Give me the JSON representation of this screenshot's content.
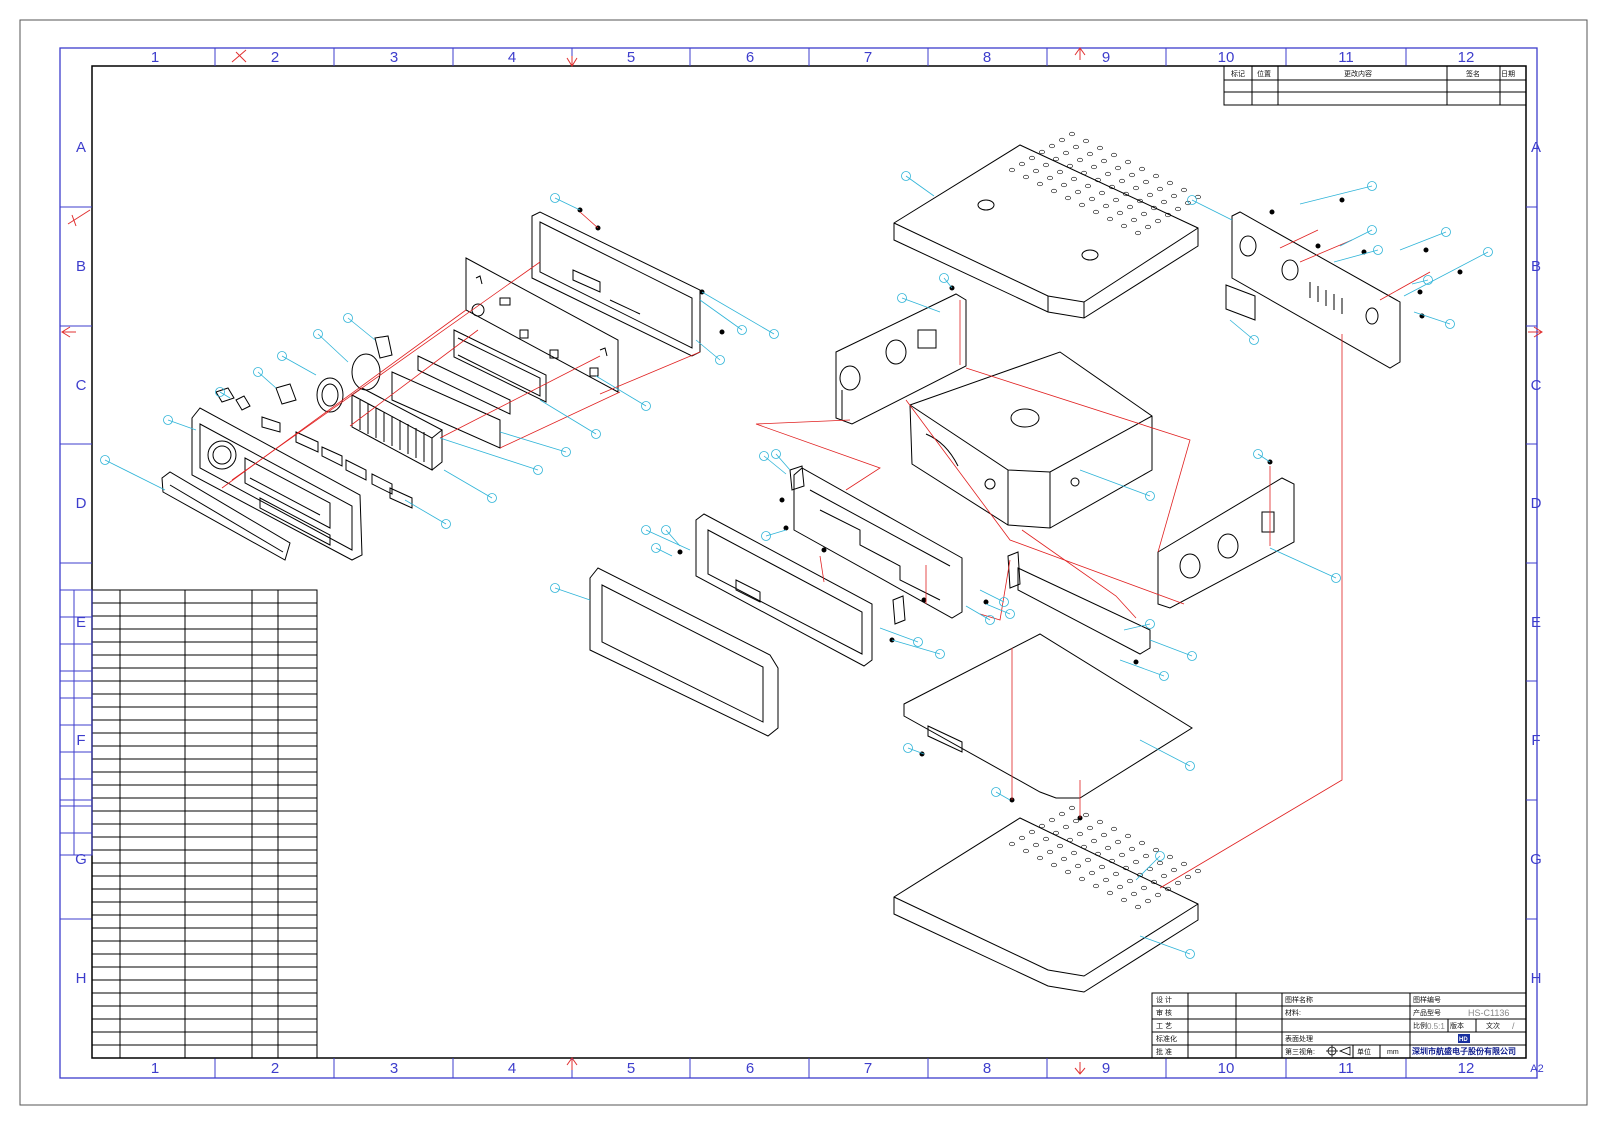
{
  "drawing": {
    "zone_columns": [
      "1",
      "2",
      "3",
      "4",
      "5",
      "6",
      "7",
      "8",
      "9",
      "10",
      "11",
      "12"
    ],
    "zone_rows": [
      "A",
      "B",
      "C",
      "D",
      "E",
      "F",
      "G",
      "H"
    ],
    "sheet_size": "A2"
  },
  "revision_table": {
    "headers": [
      "标记",
      "位置",
      "更改内容",
      "签名",
      "日期"
    ]
  },
  "title_block": {
    "design": "设 计",
    "review": "审 核",
    "process": "工 艺",
    "standard": "标准化",
    "approve": "批 准",
    "drawing_name": "图样名称",
    "material": "材料:",
    "surface": "表面处理",
    "projection": "第三视角:",
    "unit": "单位",
    "unit_value": "mm",
    "drawing_no": "图样编号",
    "product_model": "产品型号",
    "model_value": "HS-C1136",
    "scale": "比例",
    "scale_value": "0.5:1",
    "version": "版本",
    "text_no": "文次",
    "text_no_value": "/",
    "logo": "HD",
    "company": "深圳市航盛电子股份有限公司"
  },
  "colors": {
    "border": "#3d3dcc",
    "line": "#000000",
    "leader": "#2fb4d8",
    "axis": "#e02020"
  }
}
